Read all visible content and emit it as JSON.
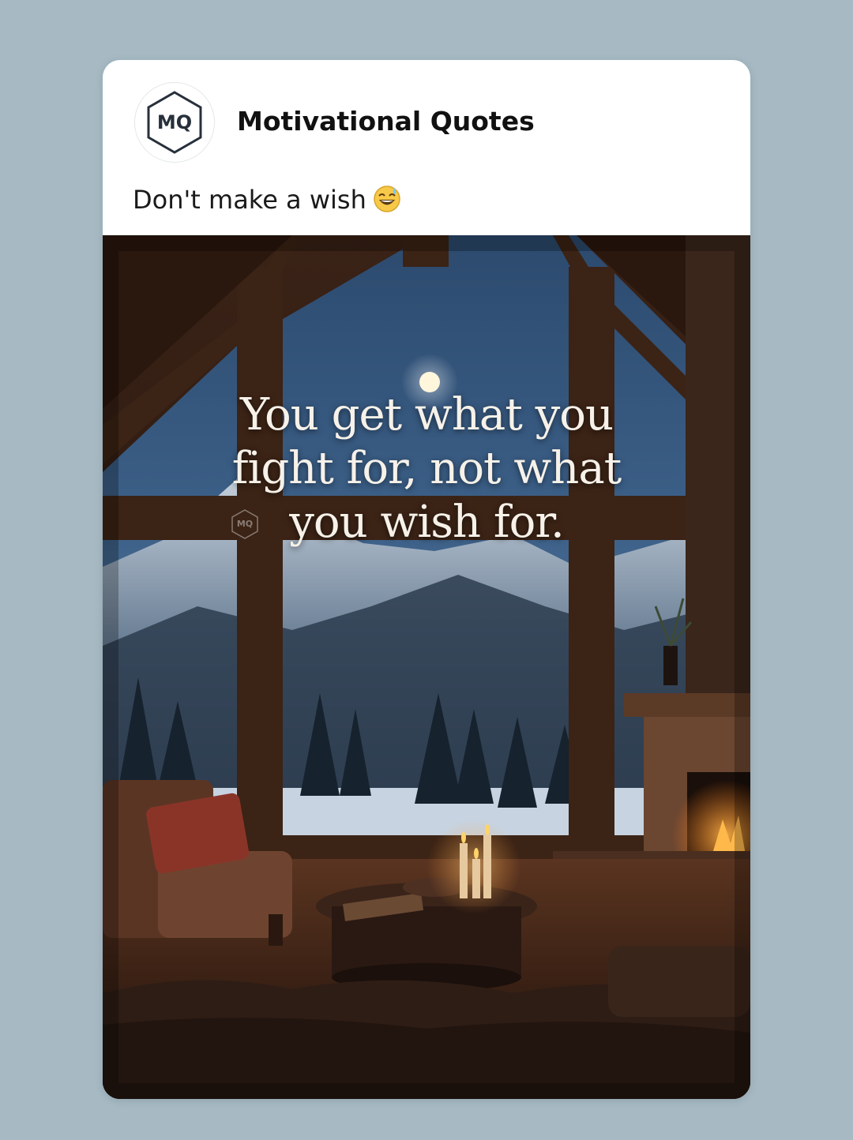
{
  "post": {
    "author": {
      "name": "Motivational Quotes",
      "avatar_initials": "MQ"
    },
    "caption": "Don't make a wish",
    "caption_emoji": "grinning-sweat-emoji",
    "image": {
      "quote_text": "You get what you fight for, not what you wish for.",
      "watermark": "MQ"
    }
  },
  "colors": {
    "background": "#a7bac4",
    "card": "#ffffff",
    "title_text": "#111111",
    "quote_text": "#f6f1e9"
  }
}
